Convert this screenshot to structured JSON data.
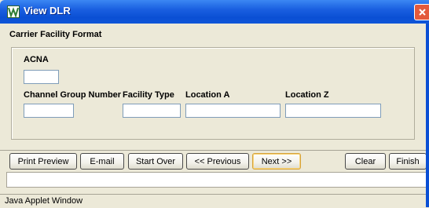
{
  "window": {
    "title": "View DLR"
  },
  "section": {
    "title": "Carrier Facility Format"
  },
  "form": {
    "acna_label": "ACNA",
    "acna_value": "",
    "channel_group_label": "Channel Group Number",
    "channel_group_value": "",
    "facility_type_label": "Facility Type",
    "facility_type_value": "",
    "location_a_label": "Location A",
    "location_a_value": "",
    "location_z_label": "Location Z",
    "location_z_value": ""
  },
  "buttons": {
    "print_preview": "Print Preview",
    "email": "E-mail",
    "start_over": "Start Over",
    "previous": "<< Previous",
    "next": "Next >>",
    "clear": "Clear",
    "finish": "Finish"
  },
  "status": {
    "applet_label": "Java Applet Window"
  },
  "icons": {
    "app": "applet-icon",
    "close": "close-icon"
  },
  "colors": {
    "titlebar": "#0a4fd4",
    "close": "#e35a3c",
    "background": "#ece9d8"
  }
}
